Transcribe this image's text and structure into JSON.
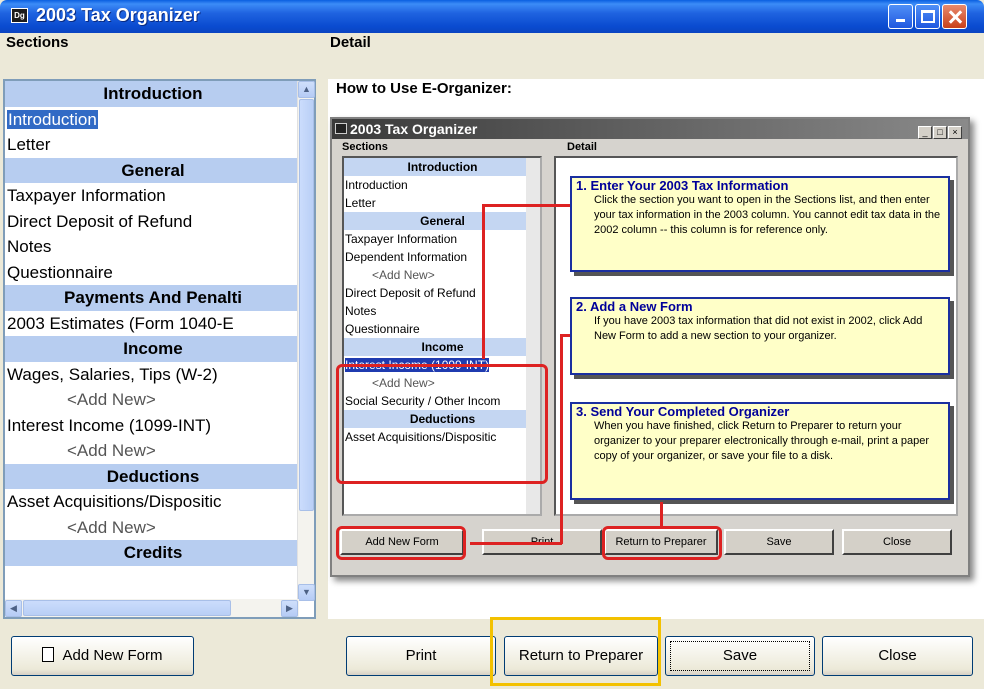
{
  "window": {
    "title": "2003 Tax Organizer",
    "icon": "app-icon"
  },
  "sections_header": "Sections",
  "detail_header": "Detail",
  "sections": [
    {
      "label": "Introduction",
      "type": "category"
    },
    {
      "label": "Introduction",
      "type": "item",
      "selected": true
    },
    {
      "label": "Letter",
      "type": "item"
    },
    {
      "label": "General",
      "type": "category"
    },
    {
      "label": "Taxpayer Information",
      "type": "item"
    },
    {
      "label": "Direct Deposit of Refund",
      "type": "item"
    },
    {
      "label": "Notes",
      "type": "item"
    },
    {
      "label": "Questionnaire",
      "type": "item"
    },
    {
      "label": "Payments And Penalti",
      "type": "category"
    },
    {
      "label": "2003 Estimates (Form 1040-E",
      "type": "item"
    },
    {
      "label": "Income",
      "type": "category"
    },
    {
      "label": "Wages, Salaries, Tips (W-2)",
      "type": "item"
    },
    {
      "label": "<Add New>",
      "type": "addnew"
    },
    {
      "label": "Interest Income (1099-INT)",
      "type": "item"
    },
    {
      "label": "<Add New>",
      "type": "addnew"
    },
    {
      "label": "Deductions",
      "type": "category"
    },
    {
      "label": "Asset Acquisitions/Dispositic",
      "type": "item"
    },
    {
      "label": "<Add New>",
      "type": "addnew"
    },
    {
      "label": "Credits",
      "type": "category"
    }
  ],
  "detail": {
    "heading": "How to Use E-Organizer:",
    "mini": {
      "title": "2003 Tax Organizer",
      "sections_header": "Sections",
      "detail_header": "Detail",
      "list": [
        {
          "label": "Introduction",
          "type": "category"
        },
        {
          "label": "Introduction",
          "type": "item"
        },
        {
          "label": "Letter",
          "type": "item"
        },
        {
          "label": "General",
          "type": "category"
        },
        {
          "label": "Taxpayer Information",
          "type": "item"
        },
        {
          "label": "Dependent Information",
          "type": "item"
        },
        {
          "label": "<Add New>",
          "type": "addnew"
        },
        {
          "label": "Direct Deposit of Refund",
          "type": "item"
        },
        {
          "label": "Notes",
          "type": "item"
        },
        {
          "label": "Questionnaire",
          "type": "item"
        },
        {
          "label": "Income",
          "type": "category"
        },
        {
          "label": "Interest Income (1099-INT)",
          "type": "item",
          "selected": true
        },
        {
          "label": "<Add New>",
          "type": "addnew"
        },
        {
          "label": "Social Security / Other Incom",
          "type": "item"
        },
        {
          "label": "Deductions",
          "type": "category"
        },
        {
          "label": "Asset Acquisitions/Dispositic",
          "type": "item"
        }
      ],
      "callouts": [
        {
          "title": "1. Enter Your 2003 Tax Information",
          "body": "Click the section you want to open in the Sections list, and then enter your tax information in the 2003 column. You cannot edit tax data in the 2002 column -- this column is for reference only."
        },
        {
          "title": "2. Add a New Form",
          "body": "If you have 2003 tax information that did not exist in 2002, click Add New Form to add a new section to your organizer."
        },
        {
          "title": "3. Send Your Completed Organizer",
          "body": "When you have finished, click Return to Preparer to return your organizer to your preparer electronically through e-mail, print a paper copy of your organizer, or save your file to a disk."
        }
      ],
      "buttons": {
        "add": "Add New Form",
        "print": "Print",
        "return": "Return to Preparer",
        "save": "Save",
        "close": "Close"
      }
    }
  },
  "buttons": {
    "add_new_form": "Add New Form",
    "print": "Print",
    "return_to_preparer": "Return to Preparer",
    "save": "Save",
    "close": "Close"
  },
  "colors": {
    "highlight": "#f3c100",
    "callout_border": "#1a2fa0",
    "annotation_red": "#dd2222"
  }
}
